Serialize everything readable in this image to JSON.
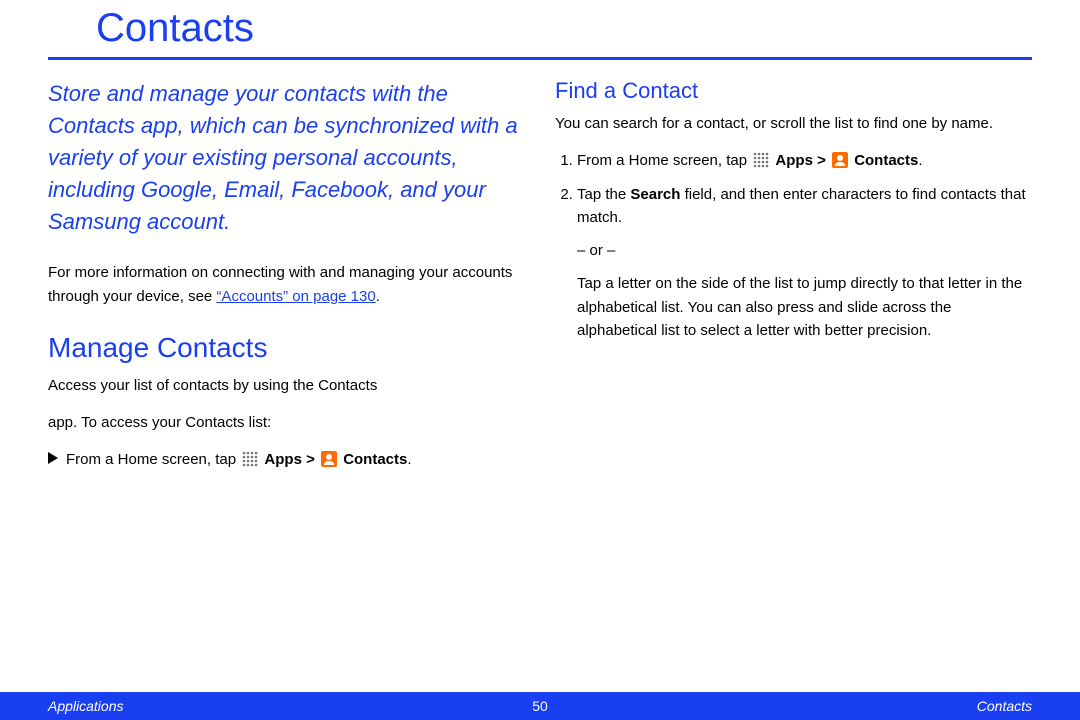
{
  "title": "Contacts",
  "intro": "Store and manage your contacts with the Contacts app, which can be synchronized with a variety of your existing personal accounts, including Google, Email, Facebook, and your Samsung account.",
  "info_prefix": "For more information on connecting with and managing your accounts through your device, see ",
  "info_link": "“Accounts” on page 130",
  "info_suffix": ".",
  "manage": {
    "heading": "Manage Contacts",
    "line1": "Access your list of contacts by using the Contacts",
    "line2": "app. To access your Contacts list:",
    "step_prefix": "From a Home screen, tap ",
    "apps_label": "Apps",
    "gt": " > ",
    "contacts_label": "Contacts",
    "step_suffix": "."
  },
  "find": {
    "heading": "Find a Contact",
    "intro": "You can search for a contact, or scroll the list to find one by name.",
    "step1_prefix": "From a Home screen, tap ",
    "apps_label": "Apps",
    "gt": " > ",
    "contacts_label": "Contacts",
    "step1_suffix": ".",
    "step2_a": "Tap the ",
    "step2_search": "Search",
    "step2_b": " field, and then enter characters to find contacts that match.",
    "or": "– or –",
    "step2_c": "Tap a letter on the side of the list to jump directly to that letter in the alphabetical list. You can also press and slide across the alphabetical list to select a letter with better precision."
  },
  "footer": {
    "left": "Applications",
    "center": "50",
    "right": "Contacts"
  }
}
